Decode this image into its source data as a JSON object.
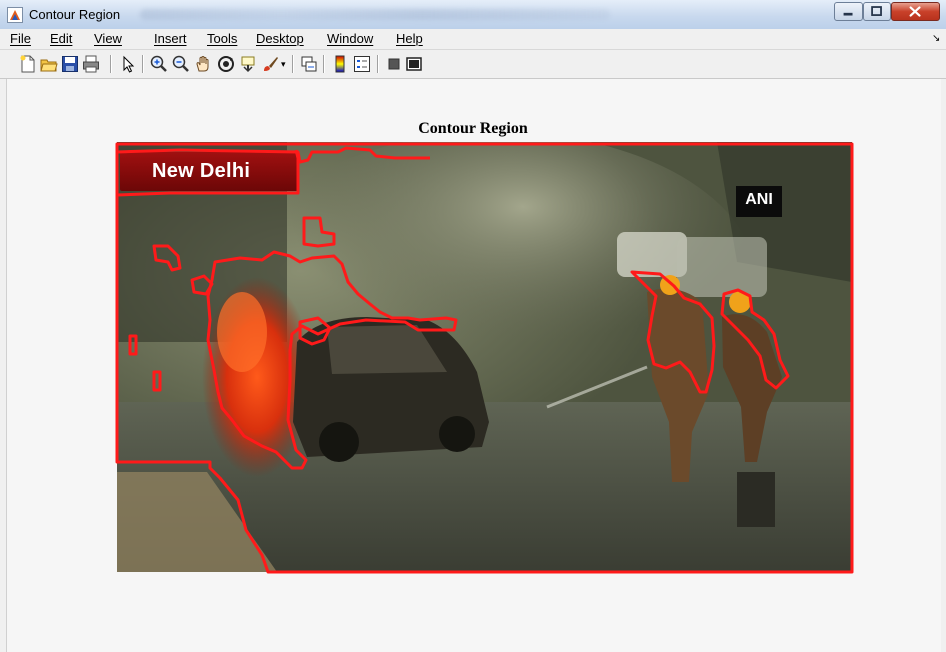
{
  "window": {
    "title": "Contour Region",
    "accent_color": "#c9412a",
    "app_icon": "matlab-figure-icon"
  },
  "menu": {
    "items": [
      {
        "label": "File",
        "name": "menu-file"
      },
      {
        "label": "Edit",
        "name": "menu-edit"
      },
      {
        "label": "View",
        "name": "menu-view"
      },
      {
        "label": "Insert",
        "name": "menu-insert"
      },
      {
        "label": "Tools",
        "name": "menu-tools"
      },
      {
        "label": "Desktop",
        "name": "menu-desktop"
      },
      {
        "label": "Window",
        "name": "menu-window"
      },
      {
        "label": "Help",
        "name": "menu-help"
      }
    ],
    "overflow_icon": "chevron-right-icon"
  },
  "toolbar": {
    "icons": [
      "new-figure-icon",
      "open-file-icon",
      "save-icon",
      "print-icon",
      "edit-plot-icon",
      "zoom-in-icon",
      "zoom-out-icon",
      "pan-icon",
      "rotate-3d-icon",
      "data-cursor-icon",
      "brush-icon",
      "link-plot-icon",
      "colorbar-icon",
      "legend-icon",
      "hide-plot-tools-icon",
      "show-plot-tools-icon"
    ]
  },
  "figure": {
    "title": "Contour Region",
    "contour_color": "#ff1a1a",
    "image_overlays": {
      "location_label": "New Delhi",
      "agency_badge": "ANI"
    }
  }
}
